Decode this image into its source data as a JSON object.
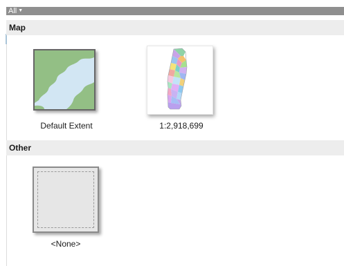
{
  "filter": {
    "label": "All",
    "chevron_icon": "chevron-down-icon"
  },
  "sections": {
    "map": {
      "title": "Map",
      "items": [
        {
          "label": "Default Extent",
          "icon": "default-extent-thumbnail"
        },
        {
          "label": "1:2,918,699",
          "icon": "portugal-map-thumbnail"
        }
      ]
    },
    "other": {
      "title": "Other",
      "items": [
        {
          "label": "<None>",
          "icon": "none-thumbnail"
        }
      ]
    }
  },
  "colors": {
    "filter_bar": "#8f8f8f",
    "section_header": "#ededed",
    "extent_land": "#93bf85",
    "extent_water": "#d2e6f3"
  }
}
